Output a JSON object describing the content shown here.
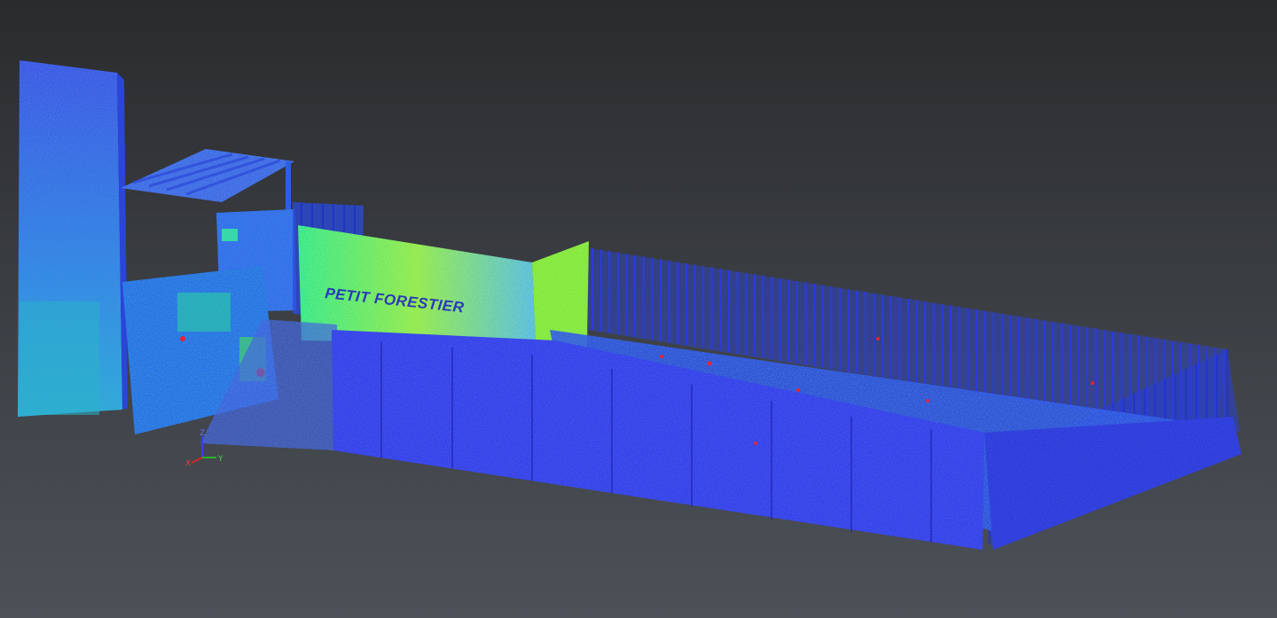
{
  "scene": {
    "sign_text": "PETIT FORESTIER",
    "background_top": "#2a2b2d",
    "background_bottom": "#4c5158",
    "scalar_colors": {
      "low": "#3a40ee",
      "mid_low": "#2a7df0",
      "mid": "#22d6d6",
      "mid_high": "#36e08a",
      "high": "#b9f22b",
      "peak": "#e8242e"
    }
  },
  "axes_gizmo": {
    "x_label": "X",
    "y_label": "Y",
    "z_label": "Z",
    "x_color": "#d12a2a",
    "y_color": "#2ab52a",
    "z_color": "#3a3aff"
  }
}
